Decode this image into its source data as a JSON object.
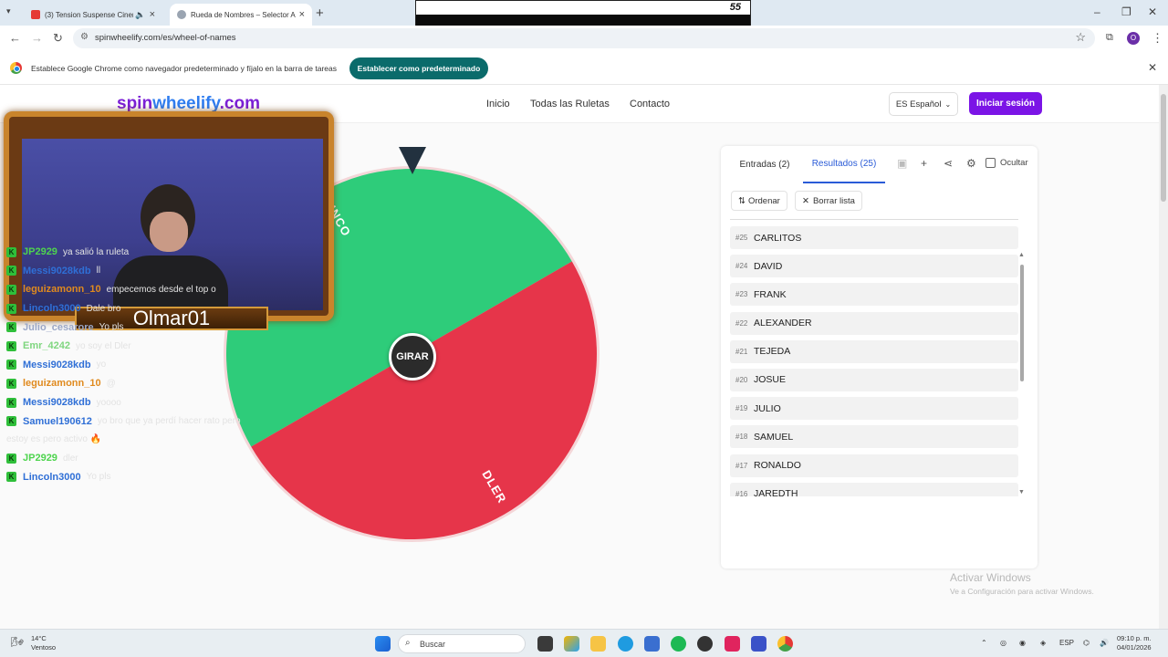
{
  "browser": {
    "tabs": [
      {
        "title": "(3) Tension Suspense Cinem",
        "active": false
      },
      {
        "title": "Rueda de Nombres – Selector A",
        "active": true
      }
    ],
    "url": "spinwheelify.com/es/wheel-of-names",
    "profile_initial": "O",
    "overlay_number": "55"
  },
  "infobar": {
    "message": "Establece Google Chrome como navegador predeterminado y fíjalo en la barra de tareas",
    "button": "Establecer como predeterminado"
  },
  "site": {
    "logo": {
      "part1": "spin",
      "part2": "wheelify",
      "part3": ".com"
    },
    "nav": [
      "Inicio",
      "Todas las Ruletas",
      "Contacto"
    ],
    "language": "ES Español",
    "login": "Iniciar sesión"
  },
  "wheel": {
    "spin_label": "GIRAR",
    "segments": [
      {
        "label": "LINCO",
        "color": "#2ecc7a"
      },
      {
        "label": "DLER",
        "color": "#e6354a"
      }
    ]
  },
  "panel": {
    "tab_entries": "Entradas (2)",
    "tab_results": "Resultados (25)",
    "hide_label": "Ocultar",
    "sort_label": "Ordenar",
    "clear_label": "Borrar lista",
    "results": [
      {
        "num": "#25",
        "name": "CARLITOS"
      },
      {
        "num": "#24",
        "name": "DAVID"
      },
      {
        "num": "#23",
        "name": "FRANK"
      },
      {
        "num": "#22",
        "name": "ALEXANDER"
      },
      {
        "num": "#21",
        "name": "TEJEDA"
      },
      {
        "num": "#20",
        "name": "JOSUE"
      },
      {
        "num": "#19",
        "name": "JULIO"
      },
      {
        "num": "#18",
        "name": "SAMUEL"
      },
      {
        "num": "#17",
        "name": "RONALDO"
      },
      {
        "num": "#16",
        "name": "JAREDTH"
      }
    ]
  },
  "stream": {
    "streamer_name": "Olmar01",
    "chat": [
      {
        "user": "JP2929",
        "color": "#4ed44e",
        "text": "ya salió la ruleta"
      },
      {
        "user": "Messi9028kdb",
        "color": "#2f6fd6",
        "text": "ll"
      },
      {
        "user": "leguizamonn_10",
        "color": "#e08a1e",
        "text": "empecemos desde el top o"
      },
      {
        "user": "Lincoln3000",
        "color": "#2f6fd6",
        "text": "Dale bro"
      },
      {
        "user": "Julio_cesarore",
        "color": "#9aa7c7",
        "text": "Yo pls"
      },
      {
        "user": "Emr_4242",
        "color": "#7fd67f",
        "text": "yo soy el Dler"
      },
      {
        "user": "Messi9028kdb",
        "color": "#2f6fd6",
        "text": "yo"
      },
      {
        "user": "leguizamonn_10",
        "color": "#e08a1e",
        "text": "@"
      },
      {
        "user": "Messi9028kdb",
        "color": "#2f6fd6",
        "text": "yoooo"
      },
      {
        "user": "Samuel190612",
        "color": "#2f6fd6",
        "text": "yo bro que ya perdí hacer rato pero"
      },
      {
        "user": "",
        "color": "",
        "text": "estoy es pero activo 🔥"
      },
      {
        "user": "JP2929",
        "color": "#4ed44e",
        "text": "dler"
      },
      {
        "user": "Lincoln3000",
        "color": "#2f6fd6",
        "text": "Yo pls"
      }
    ]
  },
  "windows": {
    "watermark_title": "Activar Windows",
    "watermark_sub": "Ve a Configuración para activar Windows.",
    "weather_temp": "14°C",
    "weather_desc": "Ventoso",
    "search_placeholder": "Buscar",
    "lang": "ESP",
    "time": "09:10 p. m.",
    "date": "04/01/2026"
  }
}
